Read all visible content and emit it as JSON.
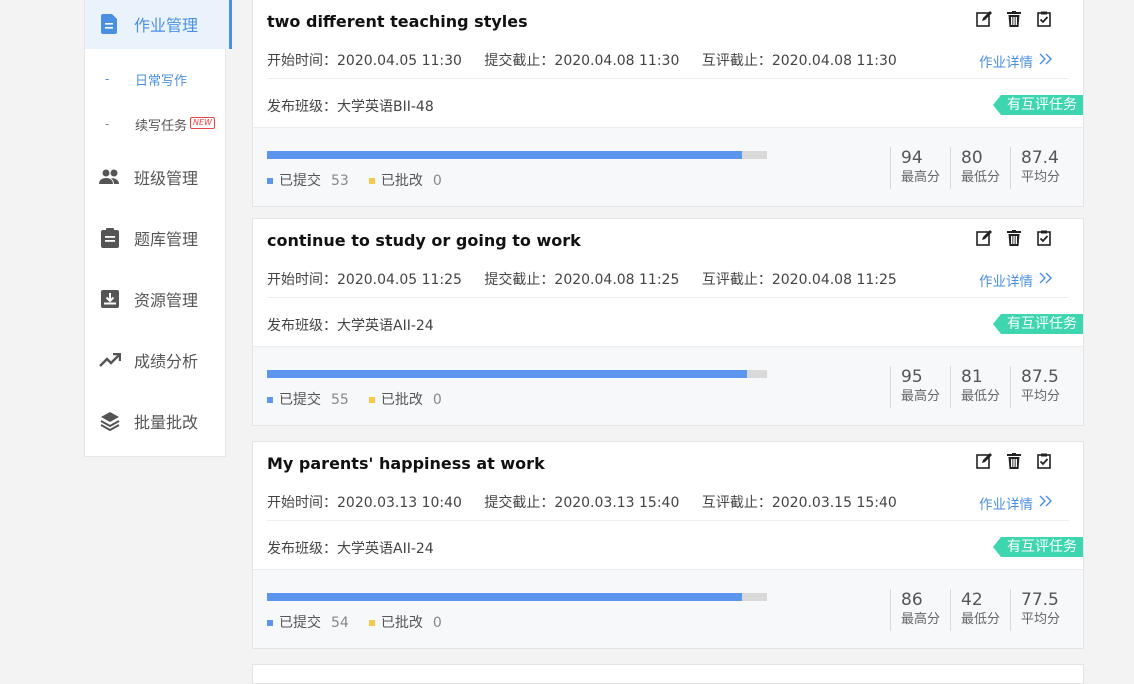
{
  "sidebar": {
    "items": [
      {
        "label": "作业管理",
        "icon": "document-icon",
        "active": true
      },
      {
        "label": "班级管理",
        "icon": "people-icon"
      },
      {
        "label": "题库管理",
        "icon": "clipboard-icon"
      },
      {
        "label": "资源管理",
        "icon": "download-tray-icon"
      },
      {
        "label": "成绩分析",
        "icon": "trending-up-icon"
      },
      {
        "label": "批量批改",
        "icon": "layers-icon"
      }
    ],
    "subitems": [
      {
        "dash": "-",
        "label": "日常写作",
        "active": true
      },
      {
        "dash": "-",
        "label": "续写任务",
        "badge": "NEW"
      }
    ]
  },
  "cards": [
    {
      "title": "two different teaching styles",
      "start": "开始时间：2020.04.05 11:30",
      "submit_deadline": "提交截止：2020.04.08 11:30",
      "peer_deadline": "互评截止：2020.04.08 11:30",
      "detail": "作业详情",
      "class_line": "发布班级：大学英语BII-48",
      "peer_badge": "有互评任务",
      "submitted_label": "已提交",
      "submitted": "53",
      "graded_label": "已批改",
      "graded": "0",
      "progress": 0.95,
      "max": "94",
      "max_label": "最高分",
      "min": "80",
      "min_label": "最低分",
      "avg": "87.4",
      "avg_label": "平均分"
    },
    {
      "title": "continue to study or going to work",
      "start": "开始时间：2020.04.05 11:25",
      "submit_deadline": "提交截止：2020.04.08 11:25",
      "peer_deadline": "互评截止：2020.04.08 11:25",
      "detail": "作业详情",
      "class_line": "发布班级：大学英语AII-24",
      "peer_badge": "有互评任务",
      "submitted_label": "已提交",
      "submitted": "55",
      "graded_label": "已批改",
      "graded": "0",
      "progress": 0.96,
      "max": "95",
      "max_label": "最高分",
      "min": "81",
      "min_label": "最低分",
      "avg": "87.5",
      "avg_label": "平均分"
    },
    {
      "title": "My parents' happiness at work",
      "start": "开始时间：2020.03.13 10:40",
      "submit_deadline": "提交截止：2020.03.13 15:40",
      "peer_deadline": "互评截止：2020.03.15 15:40",
      "detail": "作业详情",
      "class_line": "发布班级：大学英语AII-24",
      "peer_badge": "有互评任务",
      "submitted_label": "已提交",
      "submitted": "54",
      "graded_label": "已批改",
      "graded": "0",
      "progress": 0.95,
      "max": "86",
      "max_label": "最高分",
      "min": "42",
      "min_label": "最低分",
      "avg": "77.5",
      "avg_label": "平均分"
    }
  ],
  "colors": {
    "accent": "#4a90e2",
    "peer_badge": "#3dd6b0",
    "submitted_dot": "#5b95f0",
    "graded_dot": "#f7c948"
  }
}
